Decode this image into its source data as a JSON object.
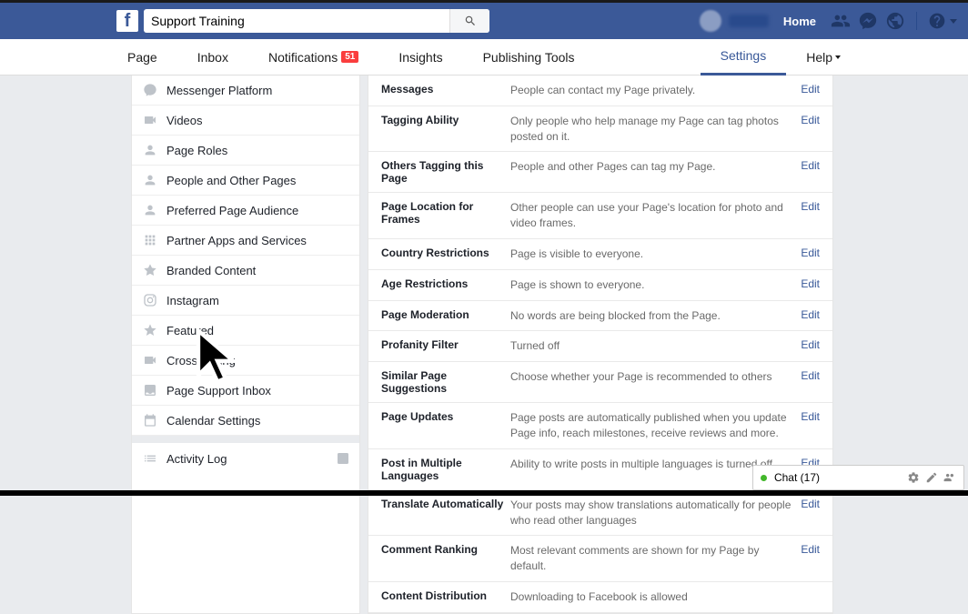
{
  "search": {
    "value": "Support Training"
  },
  "top": {
    "home": "Home"
  },
  "nav": {
    "page": "Page",
    "inbox": "Inbox",
    "notifications": "Notifications",
    "notif_badge": "51",
    "insights": "Insights",
    "publishing": "Publishing Tools",
    "settings": "Settings",
    "help": "Help"
  },
  "sidebar": {
    "items": [
      "Messenger Platform",
      "Videos",
      "Page Roles",
      "People and Other Pages",
      "Preferred Page Audience",
      "Partner Apps and Services",
      "Branded Content",
      "Instagram",
      "Featured",
      "Crossposting",
      "Page Support Inbox",
      "Calendar Settings"
    ],
    "activity_log": "Activity Log"
  },
  "settings_rows": [
    {
      "name": "Messages",
      "desc": "People can contact my Page privately.",
      "edit": "Edit"
    },
    {
      "name": "Tagging Ability",
      "desc": "Only people who help manage my Page can tag photos posted on it.",
      "edit": "Edit"
    },
    {
      "name": "Others Tagging this Page",
      "desc": "People and other Pages can tag my Page.",
      "edit": "Edit"
    },
    {
      "name": "Page Location for Frames",
      "desc": "Other people can use your Page's location for photo and video frames.",
      "edit": "Edit"
    },
    {
      "name": "Country Restrictions",
      "desc": "Page is visible to everyone.",
      "edit": "Edit"
    },
    {
      "name": "Age Restrictions",
      "desc": "Page is shown to everyone.",
      "edit": "Edit"
    },
    {
      "name": "Page Moderation",
      "desc": "No words are being blocked from the Page.",
      "edit": "Edit"
    },
    {
      "name": "Profanity Filter",
      "desc": "Turned off",
      "edit": "Edit"
    },
    {
      "name": "Similar Page Suggestions",
      "desc": "Choose whether your Page is recommended to others",
      "edit": "Edit"
    },
    {
      "name": "Page Updates",
      "desc": "Page posts are automatically published when you update Page info, reach milestones, receive reviews and more.",
      "edit": "Edit"
    },
    {
      "name": "Post in Multiple Languages",
      "desc": "Ability to write posts in multiple languages is turned off",
      "edit": "Edit"
    },
    {
      "name": "Translate Automatically",
      "desc": "Your posts may show translations automatically for people who read other languages",
      "edit": "Edit"
    },
    {
      "name": "Comment Ranking",
      "desc": "Most relevant comments are shown for my Page by default.",
      "edit": "Edit"
    },
    {
      "name": "Content Distribution",
      "desc": "Downloading to Facebook is allowed",
      "edit": ""
    }
  ],
  "chat": {
    "label": "Chat (17)"
  }
}
